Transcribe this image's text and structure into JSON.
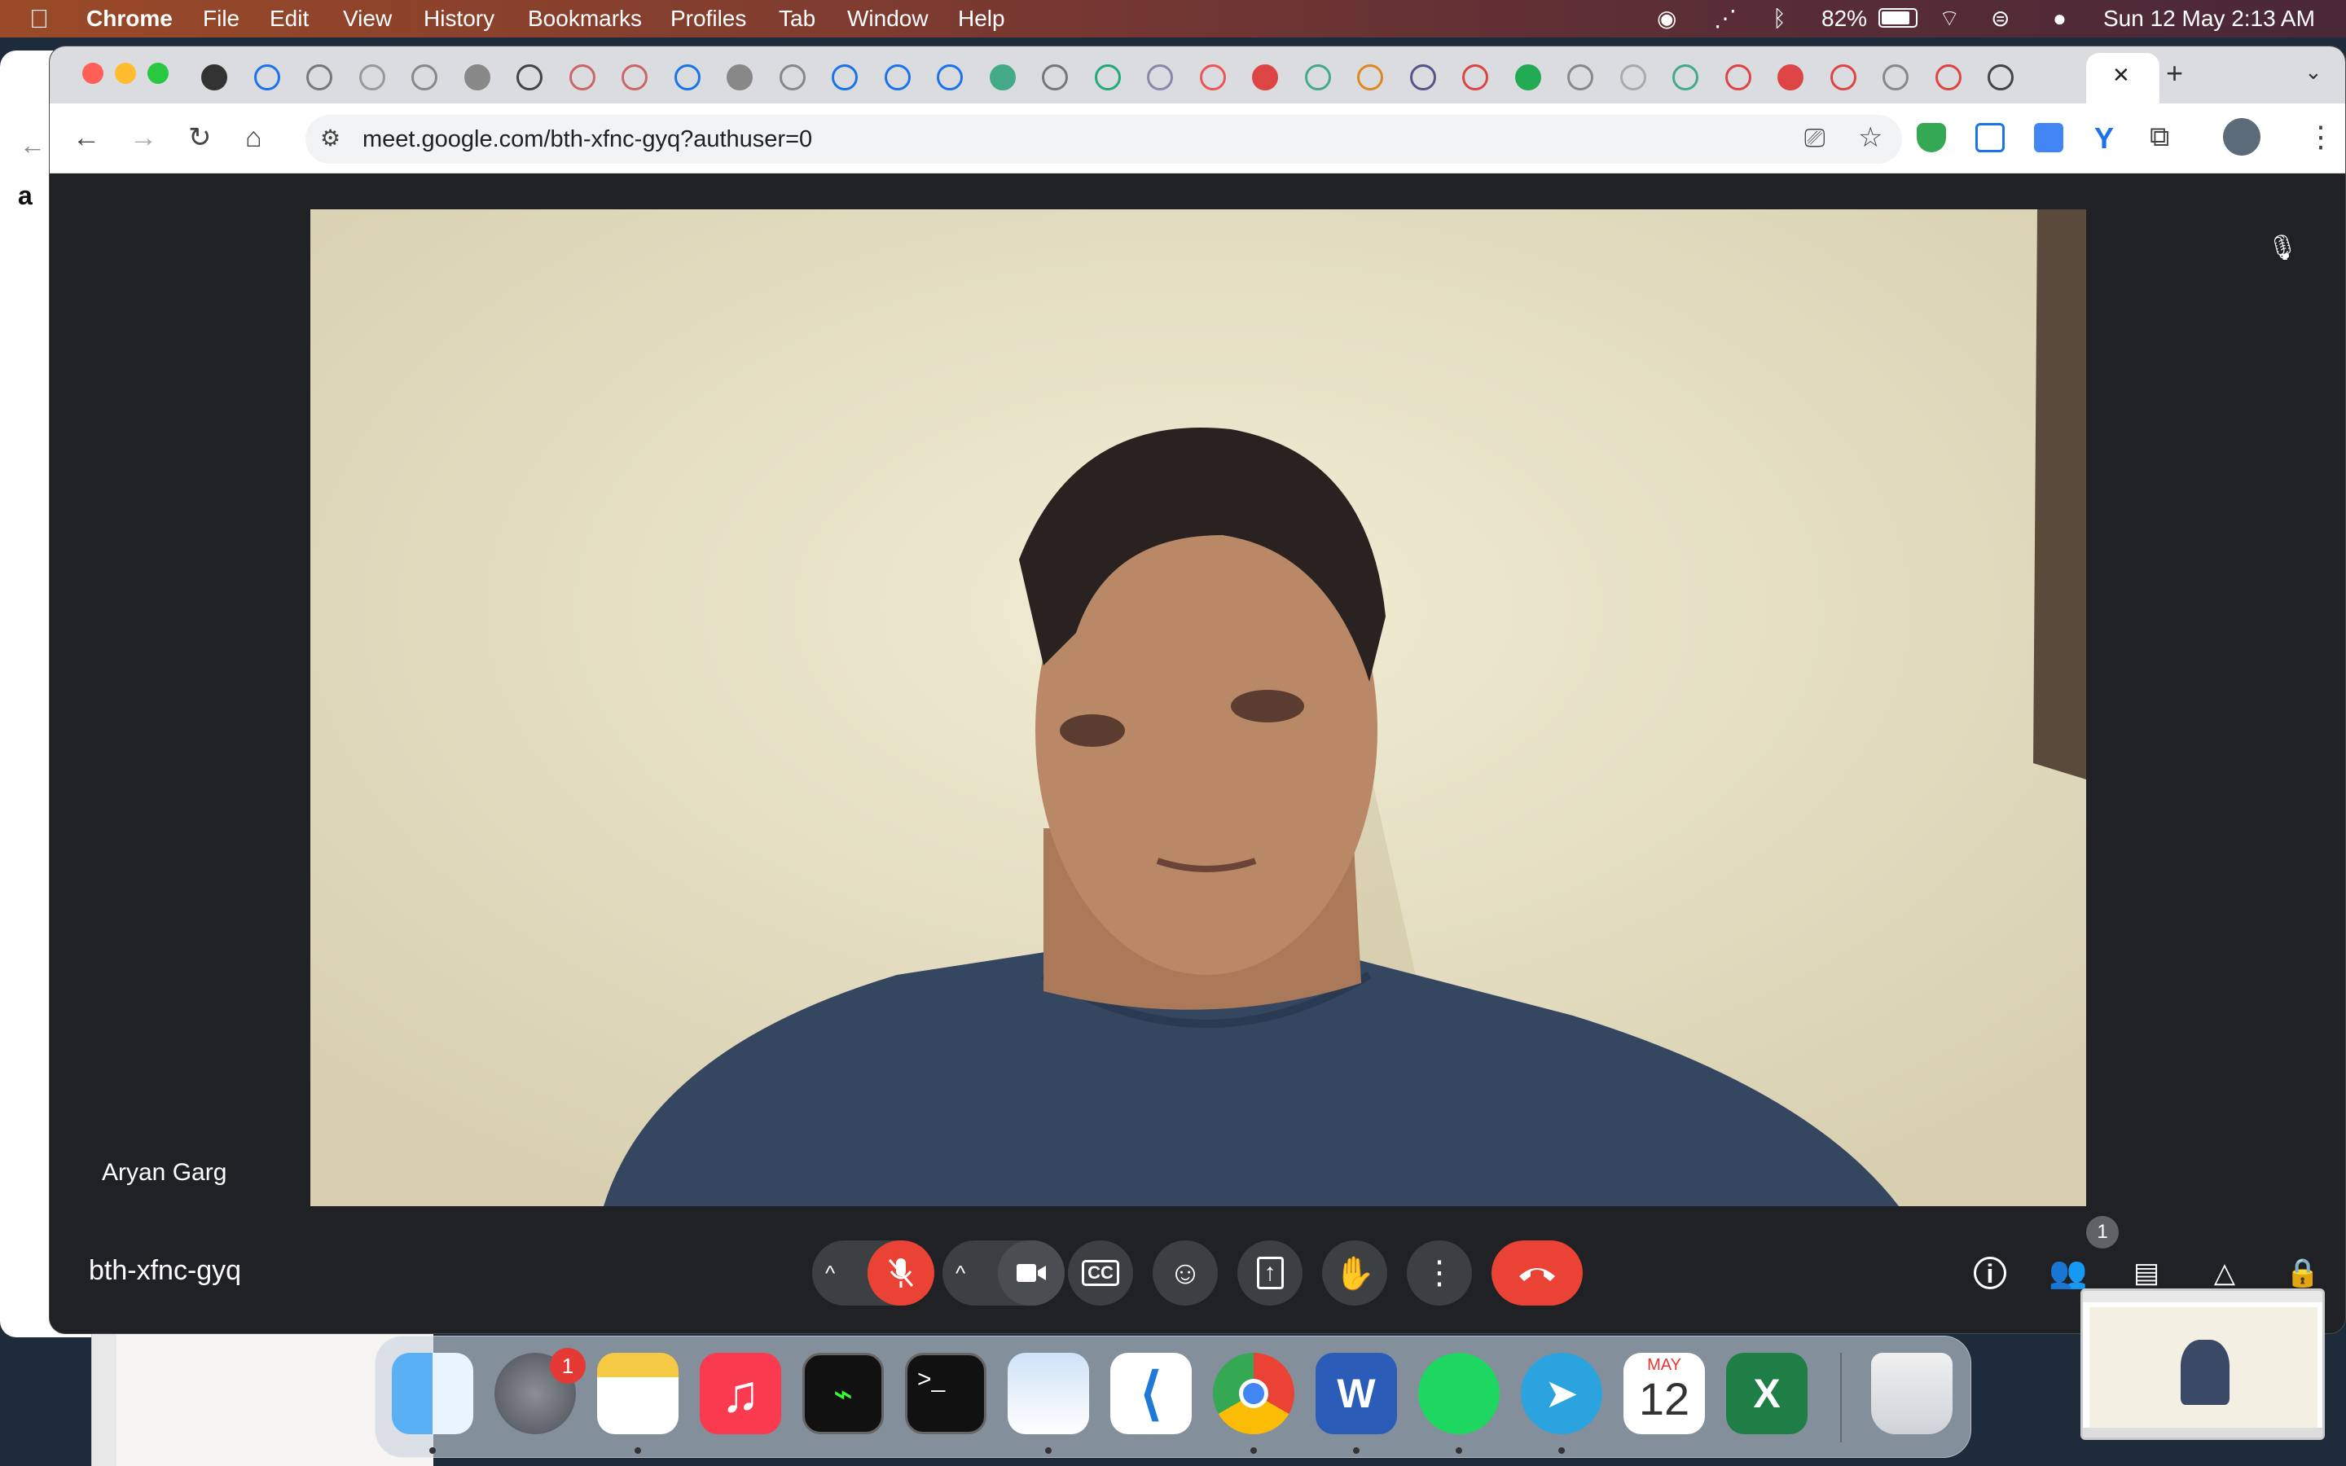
{
  "menubar": {
    "apple": "",
    "app": "Chrome",
    "items": [
      "File",
      "Edit",
      "View",
      "History",
      "Bookmarks",
      "Profiles",
      "Tab",
      "Window",
      "Help"
    ],
    "battery": "82%",
    "datetime": "Sun 12 May  2:13 AM"
  },
  "browser": {
    "url": "meet.google.com/bth-xfnc-gyq?authuser=0",
    "new_tab": "+",
    "close_tab": "✕"
  },
  "meet": {
    "participant": "Aryan Garg",
    "meeting_code": "bth-xfnc-gyq",
    "people_count": "1"
  },
  "dock": {
    "calendar_month": "MAY",
    "calendar_day": "12",
    "settings_badge": "1"
  },
  "colors": {
    "end_call": "#ea4335",
    "mic_off": "#ea4335",
    "meet_bg": "#202124"
  }
}
